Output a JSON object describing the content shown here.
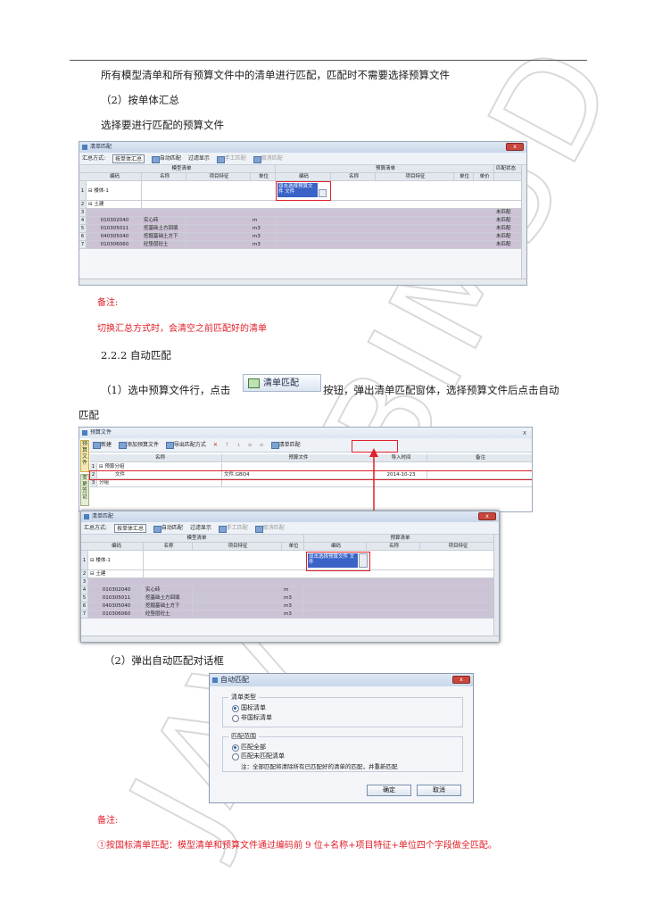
{
  "doc": {
    "line1": "所有模型清单和所有预算文件中的清单进行匹配，匹配时不需要选择预算文件",
    "line2": "（2）按单体汇总",
    "line3": "选择要进行匹配的预算文件",
    "note_label_1": "备注:",
    "note_text_1": "切换汇总方式时，会清空之前匹配好的清单",
    "section": "2.2.2 自动匹配",
    "step1_pre": "（1）选中预算文件行，点击",
    "step1_post": "按钮，弹出清单匹配窗体，选择预算文件后点击自动",
    "step1_cont": "匹配",
    "button_image_label": "清单匹配",
    "step2": "（2）弹出自动匹配对话框",
    "note_label_2": "备注:",
    "note_text_2": "①按国标清单匹配：模型清单和预算文件通过编码前 9 位+名称+项目特征+单位四个字段做全匹配。",
    "watermark": "JAVIS BIM5D"
  },
  "win1": {
    "title": "清单匹配",
    "close": "x",
    "toolbar": {
      "mode_label": "汇总方式:",
      "mode_value": "按单体汇总",
      "auto_match": "自动匹配",
      "filter": "过滤显示",
      "manual": "手工匹配",
      "cancel": "取消匹配"
    },
    "group_model": "模型清单",
    "group_budget": "预算清单",
    "group_status": "匹配状态",
    "cols": [
      "编码",
      "名称",
      "项目特征",
      "单位",
      "编码",
      "名称",
      "项目特征",
      "单位",
      "单价"
    ],
    "selected_cell": "双击选择预算文件 文件",
    "rows": [
      {
        "num": "1",
        "code": "⊟ 楼体-1",
        "name": "",
        "unit": "",
        "status": ""
      },
      {
        "num": "2",
        "code": "⊟ 土建",
        "name": "",
        "unit": "",
        "status": ""
      },
      {
        "num": "3",
        "code": "",
        "name": "",
        "unit": "",
        "status": "未匹配"
      },
      {
        "num": "4",
        "code": "010302040",
        "name": "实心砖",
        "unit": "m",
        "status": "未匹配"
      },
      {
        "num": "5",
        "code": "010305011",
        "name": "挖基础土方回填",
        "unit": "m3",
        "status": "未匹配"
      },
      {
        "num": "6",
        "code": "040305040",
        "name": "挖掘基础土方下",
        "unit": "m3",
        "status": "未匹配"
      },
      {
        "num": "7",
        "code": "010306060",
        "name": "砼垫层砼土",
        "unit": "m3",
        "status": "未匹配"
      }
    ]
  },
  "win2": {
    "title": "预算文件",
    "close": "x",
    "toolbar": {
      "add": "新建",
      "add_file": "添加预算文件",
      "export": "导出匹配方式",
      "delete": "✕",
      "up": "↑",
      "down": "↓",
      "b1": "≡",
      "b2": "≡",
      "match": "清单匹配"
    },
    "side_tab_1": "预算文件",
    "side_tab_2": "变更签证",
    "cols": [
      "名称",
      "预算文件",
      "导入时间",
      "备注"
    ],
    "rows": [
      {
        "num": "1",
        "name": "⊟ 预算分组",
        "file": "",
        "time": "",
        "note": ""
      },
      {
        "num": "2",
        "name": "文件",
        "file": "文件.GBQ4",
        "time": "2014-10-23",
        "note": ""
      },
      {
        "num": "3",
        "name": "分组",
        "file": "",
        "time": "",
        "note": ""
      }
    ]
  },
  "win3": {
    "title": "清单匹配",
    "close": "x",
    "toolbar": {
      "mode_label": "汇总方式:",
      "mode_value": "按单体汇总",
      "auto_match": "自动匹配",
      "filter": "过滤显示",
      "manual": "手工匹配",
      "cancel": "取消匹配"
    },
    "group_model": "模型清单",
    "group_budget": "预算清单",
    "cols": [
      "编码",
      "名称",
      "项目特征",
      "单位",
      "编码",
      "名称",
      "项目特征"
    ],
    "selected_cell": "双击选择预算文件 文件",
    "rows": [
      {
        "num": "1",
        "code": "⊟ 楼体-1",
        "name": "",
        "unit": ""
      },
      {
        "num": "2",
        "code": "⊟ 土建",
        "name": "",
        "unit": ""
      },
      {
        "num": "3",
        "code": "",
        "name": "",
        "unit": ""
      },
      {
        "num": "4",
        "code": "010302040",
        "name": "实心砖",
        "unit": "m"
      },
      {
        "num": "5",
        "code": "010305011",
        "name": "挖基础土方回填",
        "unit": "m3"
      },
      {
        "num": "6",
        "code": "040305040",
        "name": "挖掘基础土方下",
        "unit": "m3"
      },
      {
        "num": "7",
        "code": "010306060",
        "name": "砼垫层砼土",
        "unit": "m3"
      }
    ]
  },
  "dialog": {
    "title": "自动匹配",
    "close": "x",
    "group_type": "清单类型",
    "opt_national": "国标清单",
    "opt_nonnational": "非国标清单",
    "group_range": "匹配范围",
    "opt_all": "匹配全部",
    "opt_unmatched": "匹配未匹配清单",
    "hint": "注：全部匹配将清除所有已匹配好的清单的匹配，并重新匹配",
    "ok": "确定",
    "cancel": "取消"
  }
}
